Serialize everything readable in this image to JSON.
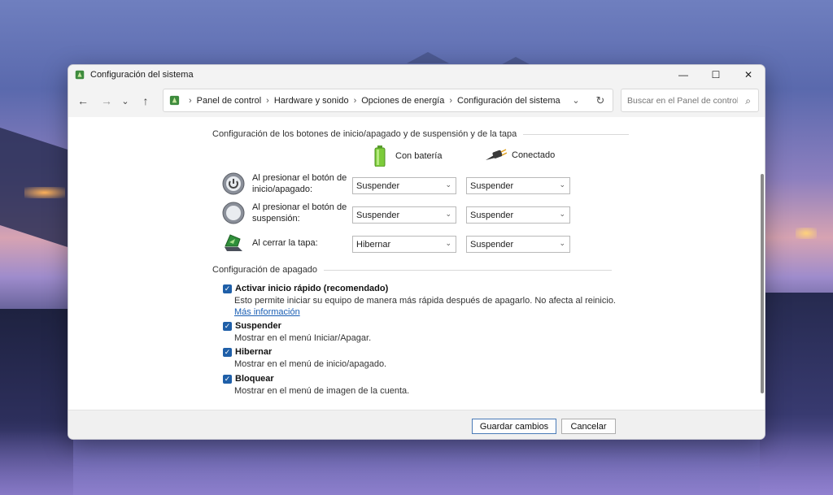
{
  "window": {
    "title": "Configuración del sistema",
    "controls": {
      "minimize": "—",
      "maximize": "☐",
      "close": "✕"
    }
  },
  "nav": {
    "back": "←",
    "forward": "→",
    "recent": "⌄",
    "up": "↑",
    "breadcrumb": [
      "Panel de control",
      "Hardware y sonido",
      "Opciones de energía",
      "Configuración del sistema"
    ],
    "separator": "›",
    "dropdown": "⌄",
    "refresh": "↻",
    "search_placeholder": "Buscar en el Panel de control",
    "search_icon": "⌕"
  },
  "buttons_section": {
    "heading": "Configuración de los botones de inicio/apagado y de suspensión y de la tapa",
    "col_battery": "Con batería",
    "col_plugged": "Conectado",
    "rows": [
      {
        "label": "Al presionar el botón de inicio/apagado:",
        "battery": "Suspender",
        "plugged": "Suspender",
        "icon": "power-button-icon"
      },
      {
        "label": "Al presionar el botón de suspensión:",
        "battery": "Suspender",
        "plugged": "Suspender",
        "icon": "sleep-button-icon"
      },
      {
        "label": "Al cerrar la tapa:",
        "battery": "Hibernar",
        "plugged": "Suspender",
        "icon": "laptop-lid-icon"
      }
    ]
  },
  "shutdown_section": {
    "heading": "Configuración de apagado",
    "options": [
      {
        "title": "Activar inicio rápido (recomendado)",
        "desc": "Esto permite iniciar su equipo de manera más rápida después de apagarlo. No afecta al reinicio.",
        "link": "Más información",
        "checked": true
      },
      {
        "title": "Suspender",
        "desc": "Mostrar en el menú Iniciar/Apagar.",
        "checked": true
      },
      {
        "title": "Hibernar",
        "desc": "Mostrar en el menú de inicio/apagado.",
        "checked": true
      },
      {
        "title": "Bloquear",
        "desc": "Mostrar en el menú de imagen de la cuenta.",
        "checked": true
      }
    ]
  },
  "footer": {
    "save": "Guardar cambios",
    "cancel": "Cancelar"
  },
  "glyphs": {
    "check": "✓",
    "caret": "⌄"
  },
  "colors": {
    "accent": "#1f5fa8",
    "link": "#1a5fb4"
  }
}
